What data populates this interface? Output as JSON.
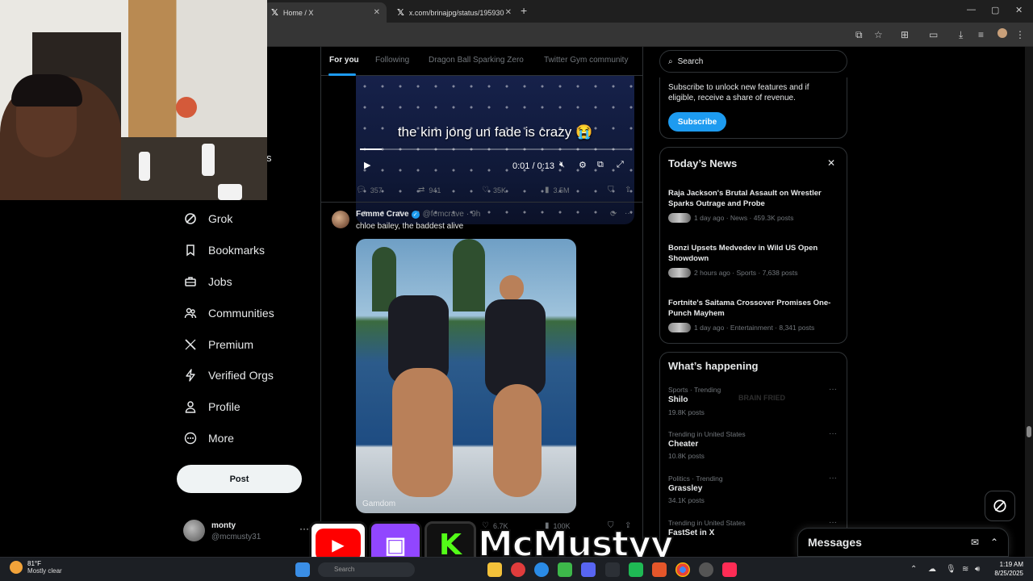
{
  "browser": {
    "tabs": [
      {
        "title": "Home / X",
        "active": true
      },
      {
        "title": "x.com/brinajpg/status/195930",
        "active": false
      }
    ],
    "new_tab": "+",
    "window_controls": [
      "—",
      "▢",
      "✕"
    ]
  },
  "nav": {
    "items": [
      {
        "label": "Grok",
        "icon": "grok-icon"
      },
      {
        "label": "Bookmarks",
        "icon": "bookmark-icon"
      },
      {
        "label": "Jobs",
        "icon": "briefcase-icon"
      },
      {
        "label": "Communities",
        "icon": "people-icon"
      },
      {
        "label": "Premium",
        "icon": "x-logo-icon"
      },
      {
        "label": "Verified Orgs",
        "icon": "lightning-icon"
      },
      {
        "label": "Profile",
        "icon": "person-icon"
      },
      {
        "label": "More",
        "icon": "more-circle-icon"
      }
    ],
    "partial_text": "s",
    "post_button": "Post",
    "account": {
      "name": "monty",
      "handle": "@mcmusty31",
      "more": "···"
    }
  },
  "feed": {
    "tabs": [
      "For you",
      "Following",
      "Dragon Ball Sparking Zero",
      "Twitter Gym community"
    ],
    "active_tab": 0,
    "video": {
      "caption": "the kim jong un fade is crazy 😭",
      "time": "0:01 / 0:13",
      "progress": 0.08
    },
    "tweet1_actions": {
      "replies": "357",
      "reposts": "941",
      "likes": "35K",
      "views": "3.5M"
    },
    "tweet2": {
      "name": "Femme Crave",
      "handle": "@femcrave",
      "time": "9h",
      "text": "chloe bailey, the baddest alive",
      "watermark": "Gamdom",
      "actions": {
        "likes": "6.7K",
        "views": "100K"
      }
    }
  },
  "right": {
    "search_placeholder": "Search",
    "subscribe": {
      "text": "Subscribe to unlock new features and if eligible, receive a share of revenue.",
      "button": "Subscribe"
    },
    "news": {
      "title": "Today’s News",
      "close": "✕",
      "items": [
        {
          "headline": "Raja Jackson's Brutal Assault on Wrestler Sparks Outrage and Probe",
          "meta": "1 day ago · News · 459.3K posts"
        },
        {
          "headline": "Bonzi Upsets Medvedev in Wild US Open Showdown",
          "meta": "2 hours ago · Sports · 7,638 posts"
        },
        {
          "headline": "Fortnite's Saitama Crossover Promises One-Punch Mayhem",
          "meta": "1 day ago · Entertainment · 8,341 posts"
        }
      ]
    },
    "happening": {
      "title": "What’s happening",
      "trends": [
        {
          "category": "Sports · Trending",
          "name": "Shilo",
          "posts": "19.8K posts"
        },
        {
          "category": "Trending in United States",
          "name": "Cheater",
          "posts": "10.8K posts"
        },
        {
          "category": "Politics · Trending",
          "name": "Grassley",
          "posts": "34.1K posts"
        },
        {
          "category": "Trending in United States",
          "name": "FastSet in X",
          "posts": ""
        }
      ]
    },
    "faint_text": "BRAIN FRIED",
    "messages_title": "Messages"
  },
  "overlay": {
    "streamer_handle": "McMustyy"
  },
  "taskbar": {
    "weather_temp": "81°F",
    "weather_desc": "Mostly clear",
    "search_placeholder": "Search",
    "time": "1:19 AM",
    "date": "8/25/2025"
  }
}
